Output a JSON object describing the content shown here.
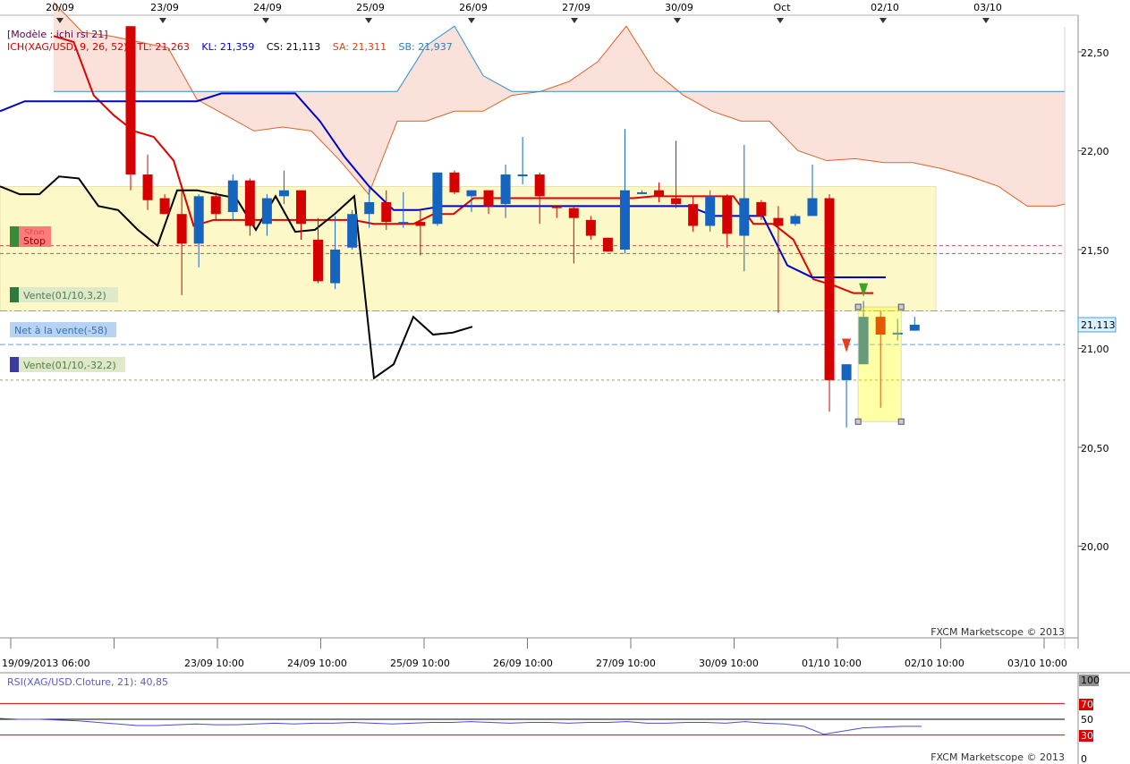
{
  "top_dates": [
    "20/09",
    "23/09",
    "24/09",
    "25/09",
    "26/09",
    "27/09",
    "30/09",
    "Oct",
    "02/10",
    "03/10"
  ],
  "legend": {
    "model": "[Modèle : ichi rsi 21]",
    "ich": "ICH(XAG/USD, 9, 26, 52) - TL: 21,263",
    "kl": "KL: 21,359",
    "cs": "CS: 21,113",
    "sa": "SA: 21,311",
    "sb": "SB: 21,937"
  },
  "order_labels": {
    "stop_top": "Stop",
    "stop": "Stop",
    "vente1": "Vente(01/10,3,2)",
    "net": "Net à la vente(-58)",
    "vente2": "Vente(01/10,-32,2)"
  },
  "price_axis": [
    "22,50",
    "22,00",
    "21,50",
    "21,00",
    "20,50",
    "20,00"
  ],
  "current_price": "21,113",
  "bottom_dates": [
    "19/09/2013 06:00",
    "23/09 10:00",
    "24/09 10:00",
    "25/09 10:00",
    "26/09 10:00",
    "27/09 10:00",
    "30/09 10:00",
    "01/10 10:00",
    "02/10 10:00",
    "03/10 10:00"
  ],
  "watermark": "FXCM Marketscope © 2013",
  "rsi": {
    "label": "RSI(XAG/USD.Cloture, 21): 40,85",
    "levels": [
      "100",
      "70",
      "50",
      "30",
      "0"
    ],
    "watermark": "FXCM Marketscope © 2013"
  },
  "colors": {
    "bull": "#1565c0",
    "bear": "#d50000",
    "tenkan": "#e00000",
    "kijun": "#0000cc",
    "chikou": "#000000",
    "cloud_bear": "#f9ddd4",
    "cloud_bull": "#d4ecf4",
    "zone": "#fdf8c8"
  },
  "chart_data": {
    "type": "candlestick",
    "instrument": "XAG/USD",
    "ylim": [
      19.6,
      22.65
    ],
    "candles": [
      {
        "o": 22.63,
        "h": 22.63,
        "l": 21.8,
        "c": 21.88
      },
      {
        "o": 21.88,
        "h": 21.98,
        "l": 21.7,
        "c": 21.75
      },
      {
        "o": 21.76,
        "h": 21.78,
        "l": 21.68,
        "c": 21.68
      },
      {
        "o": 21.68,
        "h": 21.8,
        "l": 21.27,
        "c": 21.53
      },
      {
        "o": 21.53,
        "h": 21.78,
        "l": 21.41,
        "c": 21.77
      },
      {
        "o": 21.77,
        "h": 21.79,
        "l": 21.65,
        "c": 21.68
      },
      {
        "o": 21.69,
        "h": 21.88,
        "l": 21.65,
        "c": 21.85
      },
      {
        "o": 21.85,
        "h": 21.86,
        "l": 21.57,
        "c": 21.62
      },
      {
        "o": 21.63,
        "h": 21.78,
        "l": 21.57,
        "c": 21.76
      },
      {
        "o": 21.77,
        "h": 21.9,
        "l": 21.73,
        "c": 21.8
      },
      {
        "o": 21.8,
        "h": 21.8,
        "l": 21.55,
        "c": 21.63
      },
      {
        "o": 21.55,
        "h": 21.66,
        "l": 21.33,
        "c": 21.34
      },
      {
        "o": 21.33,
        "h": 21.67,
        "l": 21.3,
        "c": 21.5
      },
      {
        "o": 21.51,
        "h": 21.7,
        "l": 21.5,
        "c": 21.68
      },
      {
        "o": 21.68,
        "h": 21.81,
        "l": 21.61,
        "c": 21.74
      },
      {
        "o": 21.74,
        "h": 21.8,
        "l": 21.6,
        "c": 21.64
      },
      {
        "o": 21.64,
        "h": 21.79,
        "l": 21.61,
        "c": 21.64
      },
      {
        "o": 21.64,
        "h": 21.7,
        "l": 21.47,
        "c": 21.62
      },
      {
        "o": 21.63,
        "h": 21.89,
        "l": 21.62,
        "c": 21.89
      },
      {
        "o": 21.89,
        "h": 21.9,
        "l": 21.78,
        "c": 21.79
      },
      {
        "o": 21.77,
        "h": 21.8,
        "l": 21.69,
        "c": 21.8
      },
      {
        "o": 21.8,
        "h": 21.8,
        "l": 21.68,
        "c": 21.72
      },
      {
        "o": 21.73,
        "h": 21.93,
        "l": 21.66,
        "c": 21.88
      },
      {
        "o": 21.88,
        "h": 22.07,
        "l": 21.83,
        "c": 21.88
      },
      {
        "o": 21.88,
        "h": 21.89,
        "l": 21.63,
        "c": 21.77
      },
      {
        "o": 21.72,
        "h": 21.72,
        "l": 21.66,
        "c": 21.71
      },
      {
        "o": 21.71,
        "h": 21.72,
        "l": 21.43,
        "c": 21.66
      },
      {
        "o": 21.65,
        "h": 21.67,
        "l": 21.55,
        "c": 21.57
      },
      {
        "o": 21.56,
        "h": 21.56,
        "l": 21.49,
        "c": 21.49
      },
      {
        "o": 21.5,
        "h": 22.11,
        "l": 21.48,
        "c": 21.8
      },
      {
        "o": 21.79,
        "h": 21.8,
        "l": 21.78,
        "c": 21.79
      },
      {
        "o": 21.8,
        "h": 21.84,
        "l": 21.74,
        "c": 21.77
      },
      {
        "o": 21.76,
        "h": 22.05,
        "l": 21.71,
        "c": 21.73
      },
      {
        "o": 21.73,
        "h": 21.77,
        "l": 21.59,
        "c": 21.62
      },
      {
        "o": 21.62,
        "h": 21.8,
        "l": 21.59,
        "c": 21.77
      },
      {
        "o": 21.77,
        "h": 21.78,
        "l": 21.51,
        "c": 21.58
      },
      {
        "o": 21.57,
        "h": 22.03,
        "l": 21.39,
        "c": 21.76
      },
      {
        "o": 21.74,
        "h": 21.75,
        "l": 21.65,
        "c": 21.67
      },
      {
        "o": 21.66,
        "h": 21.72,
        "l": 21.18,
        "c": 21.62
      },
      {
        "o": 21.63,
        "h": 21.68,
        "l": 21.62,
        "c": 21.67
      },
      {
        "o": 21.67,
        "h": 21.93,
        "l": 21.67,
        "c": 21.76
      },
      {
        "o": 21.76,
        "h": 21.78,
        "l": 20.68,
        "c": 20.84
      },
      {
        "o": 20.84,
        "h": 20.92,
        "l": 20.6,
        "c": 20.92
      },
      {
        "o": 20.92,
        "h": 21.24,
        "l": 20.92,
        "c": 21.16
      },
      {
        "o": 21.16,
        "h": 21.19,
        "l": 20.7,
        "c": 21.07
      },
      {
        "o": 21.07,
        "h": 21.15,
        "l": 21.04,
        "c": 21.08
      },
      {
        "o": 21.09,
        "h": 21.16,
        "l": 21.09,
        "c": 21.12
      }
    ],
    "tenkan": [
      22.58,
      22.55,
      22.28,
      22.18,
      22.1,
      22.07,
      21.95,
      21.62,
      21.65,
      21.65,
      21.65,
      21.65,
      21.65,
      21.65,
      21.65,
      21.65,
      21.63,
      21.63,
      21.63,
      21.68,
      21.68,
      21.76,
      21.76,
      21.76,
      21.76,
      21.76,
      21.76,
      21.76,
      21.76,
      21.76,
      21.77,
      21.77,
      21.77,
      21.77,
      21.77,
      21.63,
      21.63,
      21.55,
      21.35,
      21.32,
      21.28,
      21.28
    ],
    "kijun": [
      22.2,
      22.25,
      22.25,
      22.25,
      22.25,
      22.25,
      22.25,
      22.25,
      22.25,
      22.29,
      22.29,
      22.29,
      22.29,
      22.15,
      21.97,
      21.82,
      21.7,
      21.7,
      21.72,
      21.72,
      21.72,
      21.72,
      21.72,
      21.72,
      21.72,
      21.72,
      21.72,
      21.72,
      21.72,
      21.67,
      21.67,
      21.67,
      21.42,
      21.36,
      21.36,
      21.36,
      21.36
    ],
    "chikou": [
      21.82,
      21.78,
      21.78,
      21.87,
      21.86,
      21.72,
      21.7,
      21.6,
      21.52,
      21.8,
      21.8,
      21.78,
      21.76,
      21.6,
      21.77,
      21.59,
      21.6,
      21.68,
      21.77,
      20.85,
      20.92,
      21.16,
      21.07,
      21.08,
      21.11
    ],
    "senkou_a": [
      22.75,
      22.6,
      22.58,
      22.55,
      22.52,
      22.26,
      22.18,
      22.1,
      22.12,
      22.1,
      21.95,
      21.78,
      22.15,
      22.15,
      22.2,
      22.2,
      22.28,
      22.3,
      22.35,
      22.45,
      22.63,
      22.4,
      22.28,
      22.2,
      22.15,
      22.15,
      22.0,
      21.95,
      21.96,
      21.94,
      21.94,
      21.91,
      21.87,
      21.82,
      21.72,
      21.72,
      21.73
    ],
    "senkou_b": [
      22.3,
      22.3,
      22.3,
      22.3,
      22.3,
      22.3,
      22.3,
      22.3,
      22.3,
      22.3,
      22.3,
      22.3,
      22.3,
      22.53,
      22.63,
      22.38,
      22.3,
      22.3,
      22.3,
      22.3,
      22.3,
      22.3,
      22.3,
      22.3,
      22.3,
      22.3,
      22.3,
      22.3,
      22.3,
      22.3,
      22.3,
      22.3,
      22.3,
      22.3,
      22.3,
      22.3,
      22.3
    ],
    "horizontal_lines": {
      "stop": [
        21.52,
        21.48
      ],
      "net_position": 21.02,
      "vente": 20.84,
      "chart_line": 21.19
    },
    "rsi_values": [
      51,
      50,
      50,
      49,
      48,
      46,
      44,
      42,
      42,
      43,
      44,
      43,
      43,
      44,
      45,
      44,
      45,
      45,
      46,
      45,
      44,
      45,
      46,
      46,
      47,
      46,
      45,
      46,
      46,
      45,
      46,
      46,
      47,
      45,
      45,
      46,
      46,
      45,
      47,
      45,
      44,
      41,
      31,
      35,
      39,
      40,
      41,
      41
    ]
  }
}
